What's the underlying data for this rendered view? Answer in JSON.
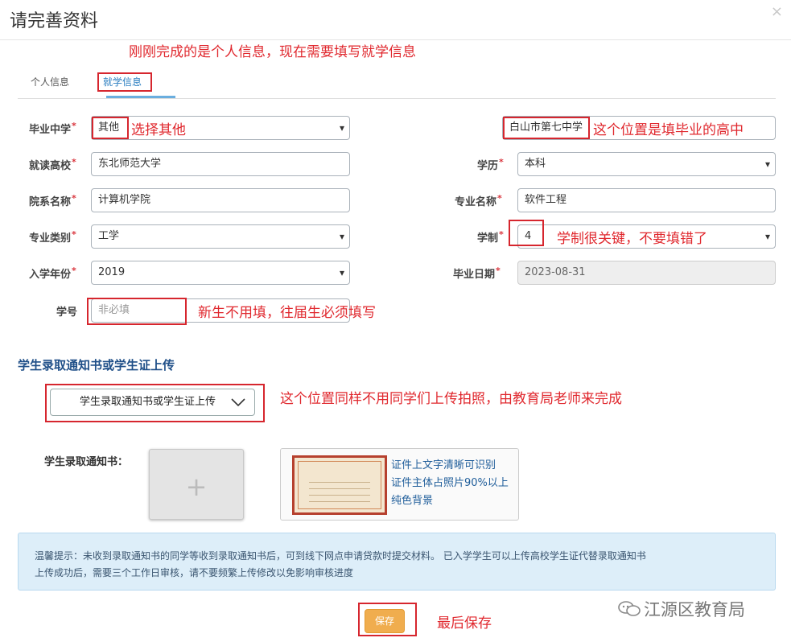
{
  "dialog": {
    "title": "请完善资料",
    "close_glyph": "×"
  },
  "tabs": [
    {
      "label": "个人信息"
    },
    {
      "label": "就学信息"
    }
  ],
  "form": {
    "high_school": {
      "label": "毕业中学",
      "value": "其他"
    },
    "high_school_name": {
      "value": "白山市第七中学"
    },
    "university": {
      "label": "就读高校",
      "value": "东北师范大学"
    },
    "degree": {
      "label": "学历",
      "value": "本科"
    },
    "department": {
      "label": "院系名称",
      "value": "计算机学院"
    },
    "major": {
      "label": "专业名称",
      "value": "软件工程"
    },
    "major_category": {
      "label": "专业类别",
      "value": "工学"
    },
    "duration": {
      "label": "学制",
      "value": "4"
    },
    "entry_year": {
      "label": "入学年份",
      "value": "2019"
    },
    "graduation_date": {
      "label": "毕业日期",
      "value": "2023-08-31"
    },
    "student_id": {
      "label": "学号",
      "placeholder": "非必填"
    },
    "required_mark": "*"
  },
  "upload": {
    "section_title": "学生录取通知书或学生证上传",
    "dropdown_label": "学生录取通知书或学生证上传",
    "label": "学生录取通知书：",
    "plus": "+",
    "sample_lines": [
      "证件上文字清晰可识别",
      "证件主体占照片90%以上",
      "纯色背景"
    ]
  },
  "notice": {
    "line1": "温馨提示：未收到录取通知书的同学等收到录取通知书后，可到线下网点申请贷款时提交材料。 已入学学生可以上传高校学生证代替录取通知书",
    "line2": "上传成功后，需要三个工作日审核，请不要频繁上传修改以免影响审核进度"
  },
  "save_label": "保存",
  "annotations": {
    "top": "刚刚完成的是个人信息，现在需要填写就学信息",
    "choose_other": "选择其他",
    "high_school_hint": "这个位置是填毕业的高中",
    "duration_hint": "学制很关键，不要填错了",
    "student_id_hint": "新生不用填，往届生必须填写",
    "upload_hint": "这个位置同样不用同学们上传拍照，由教育局老师来完成",
    "save_hint": "最后保存"
  },
  "watermark": "江源区教育局",
  "colors": {
    "annotation_red": "#e0282e",
    "save_orange": "#f0ad4e",
    "tab_active": "#2a7ec0",
    "notice_bg": "#ddeef9"
  }
}
